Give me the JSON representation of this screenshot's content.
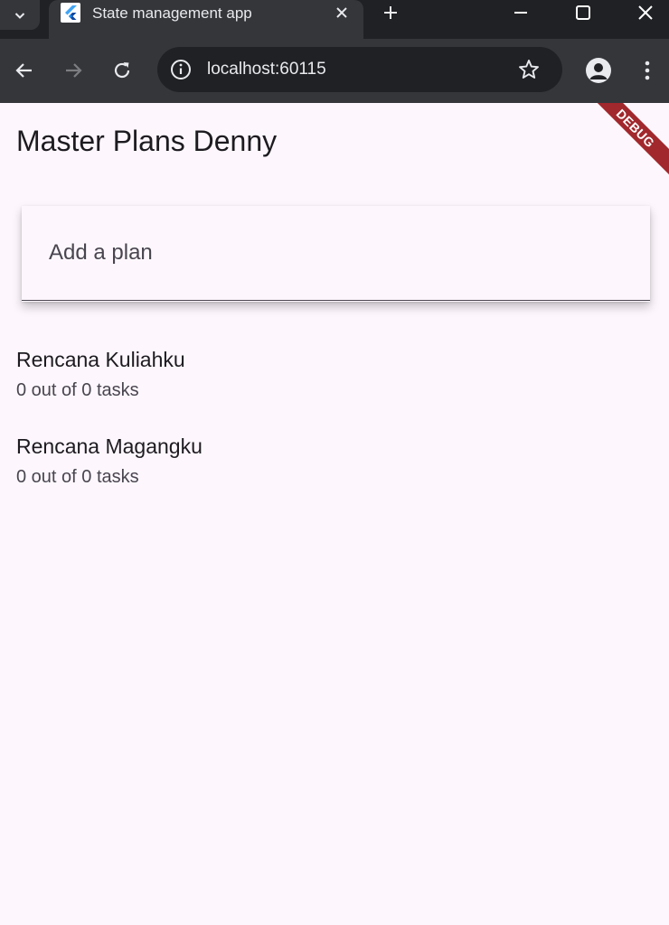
{
  "browser": {
    "tab_title": "State management app",
    "url": "localhost:60115"
  },
  "app": {
    "title": "Master Plans Denny",
    "debug_banner": "DEBUG",
    "input_placeholder": "Add a plan",
    "plans": [
      {
        "name": "Rencana Kuliahku",
        "progress": "0 out of 0 tasks"
      },
      {
        "name": "Rencana Magangku",
        "progress": "0 out of 0 tasks"
      }
    ]
  },
  "icons": {
    "tab_search": "chevron-down-icon",
    "favicon": "flutter-icon",
    "tab_close": "close-icon",
    "new_tab": "plus-icon",
    "minimize": "minimize-icon",
    "maximize": "maximize-icon",
    "close_window": "close-icon",
    "back": "arrow-left-icon",
    "forward": "arrow-right-icon",
    "reload": "reload-icon",
    "site_info": "info-icon",
    "bookmark": "star-icon",
    "profile": "person-icon",
    "menu": "more-vertical-icon"
  },
  "colors": {
    "background": "#fdf7fd",
    "debug_banner": "#a1282d",
    "chrome_dark": "#202124",
    "chrome_toolbar": "#35363a"
  }
}
